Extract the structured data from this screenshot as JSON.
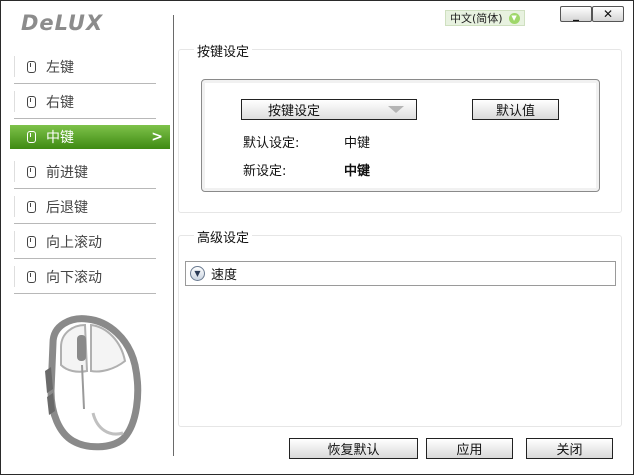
{
  "header": {
    "logo": "DeLUX",
    "language": "中文(简体)",
    "minimize_label": "_",
    "close_label": "✕"
  },
  "sidebar": {
    "items": [
      {
        "label": "左键",
        "active": false
      },
      {
        "label": "右键",
        "active": false
      },
      {
        "label": "中键",
        "active": true
      },
      {
        "label": "前进键",
        "active": false
      },
      {
        "label": "后退键",
        "active": false
      },
      {
        "label": "向上滚动",
        "active": false
      },
      {
        "label": "向下滚动",
        "active": false
      }
    ],
    "active_arrow": ">"
  },
  "key_settings": {
    "title": "按键设定",
    "select_value": "按键设定",
    "default_button": "默认值",
    "default_setting_label": "默认设定:",
    "default_setting_value": "中键",
    "new_setting_label": "新设定:",
    "new_setting_value": "中键"
  },
  "advanced": {
    "title": "高级设定",
    "speed_label": "速度"
  },
  "footer": {
    "restore_button": "恢复默认",
    "apply_button": "应用",
    "close_button": "关闭"
  },
  "colors": {
    "accent_green": "#5aa626",
    "language_badge": "#e8f2e0"
  }
}
